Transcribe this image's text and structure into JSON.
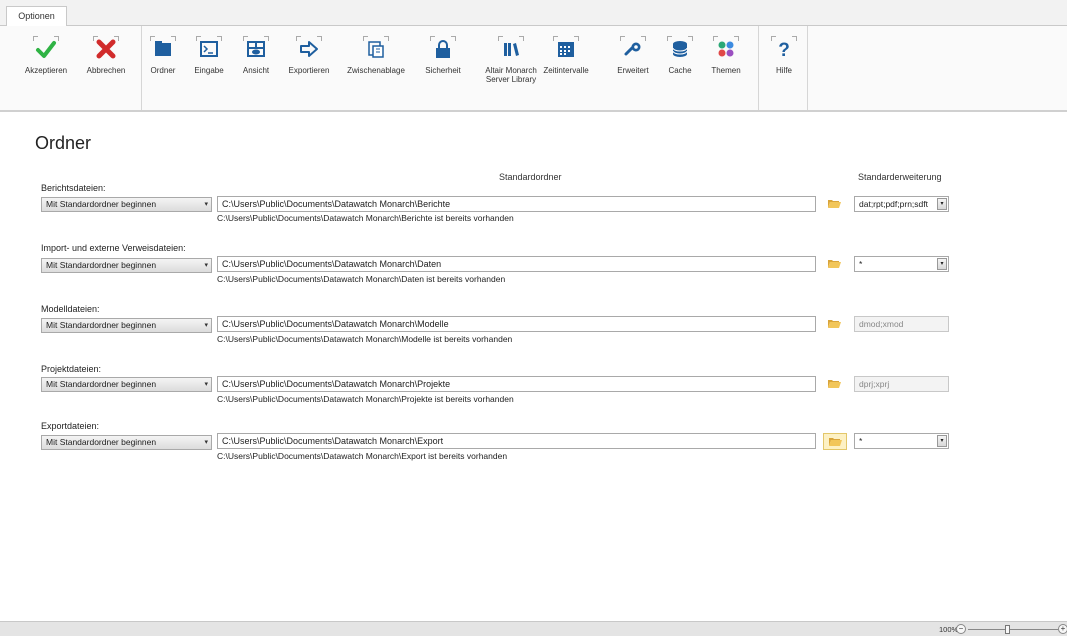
{
  "tabs": [
    {
      "label": "Optionen"
    }
  ],
  "ribbon": {
    "buttons": [
      {
        "label": "Akzeptieren",
        "icon": "checkmark-icon",
        "color": "#2fb344"
      },
      {
        "label": "Abbrechen",
        "icon": "x-icon",
        "color": "#d12b2b"
      },
      {
        "label": "Ordner",
        "icon": "folder-icon",
        "color": "#1f5f9f"
      },
      {
        "label": "Eingabe",
        "icon": "terminal-icon",
        "color": "#1f5f9f"
      },
      {
        "label": "Ansicht",
        "icon": "view-icon",
        "color": "#1f5f9f"
      },
      {
        "label": "Exportieren",
        "icon": "export-arrow-icon",
        "color": "#1f5f9f"
      },
      {
        "label": "Zwischenablage",
        "icon": "clipboard-icon",
        "color": "#1f5f9f"
      },
      {
        "label": "Sicherheit",
        "icon": "lock-icon",
        "color": "#1f5f9f"
      },
      {
        "label": "Altair Monarch",
        "label2": "Server Library",
        "icon": "library-icon",
        "color": "#1f5f9f"
      },
      {
        "label": "Zeitintervalle",
        "icon": "calendar-icon",
        "color": "#1f5f9f"
      },
      {
        "label": "Erweitert",
        "icon": "wrench-gear-icon",
        "color": "#1f5f9f"
      },
      {
        "label": "Cache",
        "icon": "database-icon",
        "color": "#1f5f9f"
      },
      {
        "label": "Themen",
        "icon": "palette-icon",
        "color": "#9a4fc0"
      },
      {
        "label": "Hilfe",
        "icon": "help-icon",
        "color": "#1f5f9f"
      }
    ]
  },
  "page": {
    "title": "Ordner",
    "col_standardordner": "Standardordner",
    "col_erweiterung": "Standarderweiterung"
  },
  "rows": [
    {
      "label": "Berichtsdateien:",
      "mode": "Mit Standardordner beginnen",
      "path": "C:\\Users\\Public\\Documents\\Datawatch Monarch\\Berichte",
      "status": "C:\\Users\\Public\\Documents\\Datawatch Monarch\\Berichte ist bereits vorhanden",
      "ext": "dat;rpt;pdf;prn;sdft"
    },
    {
      "label": "Import- und externe Verweisdateien:",
      "mode": "Mit Standardordner beginnen",
      "path": "C:\\Users\\Public\\Documents\\Datawatch Monarch\\Daten",
      "status": "C:\\Users\\Public\\Documents\\Datawatch Monarch\\Daten ist bereits vorhanden",
      "ext": "*"
    },
    {
      "label": "Modelldateien:",
      "mode": "Mit Standardordner beginnen",
      "path": "C:\\Users\\Public\\Documents\\Datawatch Monarch\\Modelle",
      "status": "C:\\Users\\Public\\Documents\\Datawatch Monarch\\Modelle ist bereits vorhanden",
      "ext": "dmod;xmod"
    },
    {
      "label": "Projektdateien:",
      "mode": "Mit Standardordner beginnen",
      "path": "C:\\Users\\Public\\Documents\\Datawatch Monarch\\Projekte",
      "status": "C:\\Users\\Public\\Documents\\Datawatch Monarch\\Projekte ist bereits vorhanden",
      "ext": "dprj;xprj"
    },
    {
      "label": "Exportdateien:",
      "mode": "Mit Standardordner beginnen",
      "path": "C:\\Users\\Public\\Documents\\Datawatch Monarch\\Export",
      "status": "C:\\Users\\Public\\Documents\\Datawatch Monarch\\Export ist bereits vorhanden",
      "ext": "*"
    }
  ],
  "statusbar": {
    "zoom": "100%"
  }
}
